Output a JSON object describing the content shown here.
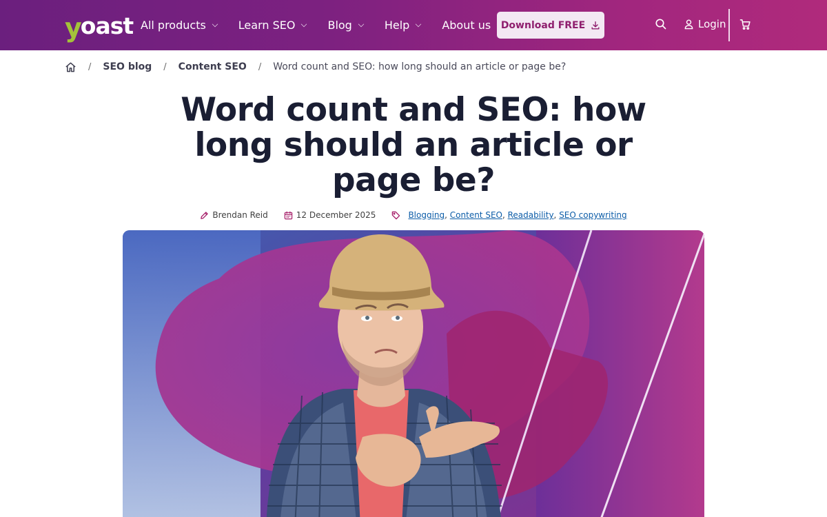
{
  "header": {
    "logo_text": "yoast",
    "nav": [
      {
        "label": "All products"
      },
      {
        "label": "Learn SEO"
      },
      {
        "label": "Blog"
      },
      {
        "label": "Help"
      },
      {
        "label": "About us"
      }
    ],
    "download_label": "Download FREE",
    "login_label": "Login"
  },
  "breadcrumb": {
    "items": [
      "SEO blog",
      "Content SEO"
    ],
    "current": "Word count and SEO: how long should an article or page be?",
    "separator": "/"
  },
  "article": {
    "title": "Word count and SEO: how long should an article or page be?",
    "author": "Brendan Reid",
    "date": "12 December 2025",
    "tags": [
      "Blogging",
      "Content SEO",
      "Readability",
      "SEO copywriting"
    ]
  },
  "hero": {
    "subject": "man in straw hat counting on fingers"
  },
  "colors": {
    "header_gradient_start": "#6b1f7e",
    "header_gradient_end": "#b02a7c",
    "logo_accent": "#a4c23a",
    "button_bg": "#f3e8f3",
    "button_text": "#8f1f6e",
    "link": "#0d5da8",
    "meta_icon": "#a61e69"
  }
}
